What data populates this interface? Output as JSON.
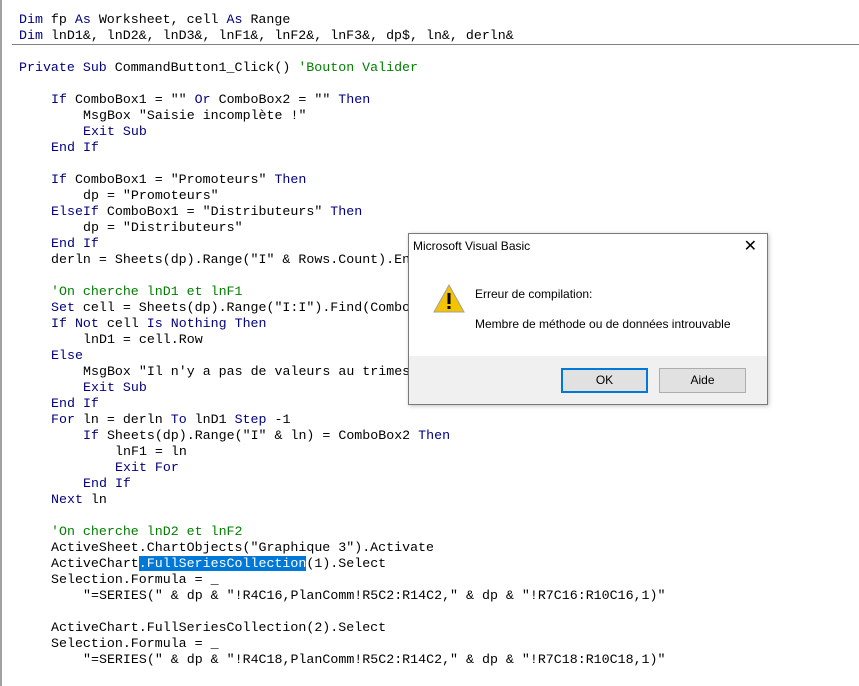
{
  "code_lines": [
    {
      "indent": 0,
      "text": "Dim fp As Worksheet, cell As Range"
    },
    {
      "indent": 0,
      "text": "Dim lnD1&, lnD2&, lnD3&, lnF1&, lnF2&, lnF3&, dp$, ln&, derln&"
    },
    {
      "indent": 0,
      "text": ""
    },
    {
      "indent": 0,
      "text": "Private Sub CommandButton1_Click() 'Bouton Valider"
    },
    {
      "indent": 0,
      "text": ""
    },
    {
      "indent": 1,
      "text": "If ComboBox1 = \"\" Or ComboBox2 = \"\" Then"
    },
    {
      "indent": 2,
      "text": "MsgBox \"Saisie incomplète !\""
    },
    {
      "indent": 2,
      "text": "Exit Sub"
    },
    {
      "indent": 1,
      "text": "End If"
    },
    {
      "indent": 0,
      "text": ""
    },
    {
      "indent": 1,
      "text": "If ComboBox1 = \"Promoteurs\" Then"
    },
    {
      "indent": 2,
      "text": "dp = \"Promoteurs\""
    },
    {
      "indent": 1,
      "text": "ElseIf ComboBox1 = \"Distributeurs\" Then"
    },
    {
      "indent": 2,
      "text": "dp = \"Distributeurs\""
    },
    {
      "indent": 1,
      "text": "End If"
    },
    {
      "indent": 1,
      "text": "derln = Sheets(dp).Range(\"I\" & Rows.Count).En"
    },
    {
      "indent": 0,
      "text": ""
    },
    {
      "indent": 1,
      "text": "'On cherche lnD1 et lnF1"
    },
    {
      "indent": 1,
      "text": "Set cell = Sheets(dp).Range(\"I:I\").Find(Combo"
    },
    {
      "indent": 1,
      "text": "If Not cell Is Nothing Then"
    },
    {
      "indent": 2,
      "text": "lnD1 = cell.Row"
    },
    {
      "indent": 1,
      "text": "Else"
    },
    {
      "indent": 2,
      "text": "MsgBox \"Il n'y a pas de valeurs au trimes"
    },
    {
      "indent": 2,
      "text": "Exit Sub"
    },
    {
      "indent": 1,
      "text": "End If"
    },
    {
      "indent": 1,
      "text": "For ln = derln To lnD1 Step -1"
    },
    {
      "indent": 2,
      "text": "If Sheets(dp).Range(\"I\" & ln) = ComboBox2 Then"
    },
    {
      "indent": 3,
      "text": "lnF1 = ln"
    },
    {
      "indent": 3,
      "text": "Exit For"
    },
    {
      "indent": 2,
      "text": "End If"
    },
    {
      "indent": 1,
      "text": "Next ln"
    },
    {
      "indent": 0,
      "text": ""
    },
    {
      "indent": 1,
      "text": "'On cherche lnD2 et lnF2"
    },
    {
      "indent": 1,
      "text": "ActiveSheet.ChartObjects(\"Graphique 3\").Activate"
    },
    {
      "indent": 1,
      "text": "ActiveChart",
      "selected": ".FullSeriesCollection",
      "after": "(1).Select"
    },
    {
      "indent": 1,
      "text": "Selection.Formula = _"
    },
    {
      "indent": 2,
      "text": "\"=SERIES(\" & dp & \"!R4C16,PlanComm!R5C2:R14C2,\" & dp & \"!R7C16:R10C16,1)\""
    },
    {
      "indent": 0,
      "text": ""
    },
    {
      "indent": 1,
      "text": "ActiveChart.FullSeriesCollection(2).Select"
    },
    {
      "indent": 1,
      "text": "Selection.Formula = _"
    },
    {
      "indent": 2,
      "text": "\"=SERIES(\" & dp & \"!R4C18,PlanComm!R5C2:R14C2,\" & dp & \"!R7C18:R10C18,1)\""
    }
  ],
  "dialog": {
    "title": "Microsoft Visual Basic",
    "icon": "warning-icon",
    "heading": "Erreur de compilation:",
    "message": "Membre de méthode ou de données introuvable",
    "ok_label": "OK",
    "help_label": "Aide",
    "close_glyph": "✕"
  },
  "colors": {
    "keyword": "#00007f",
    "comment": "#007f00",
    "selection": "#0078d7"
  }
}
